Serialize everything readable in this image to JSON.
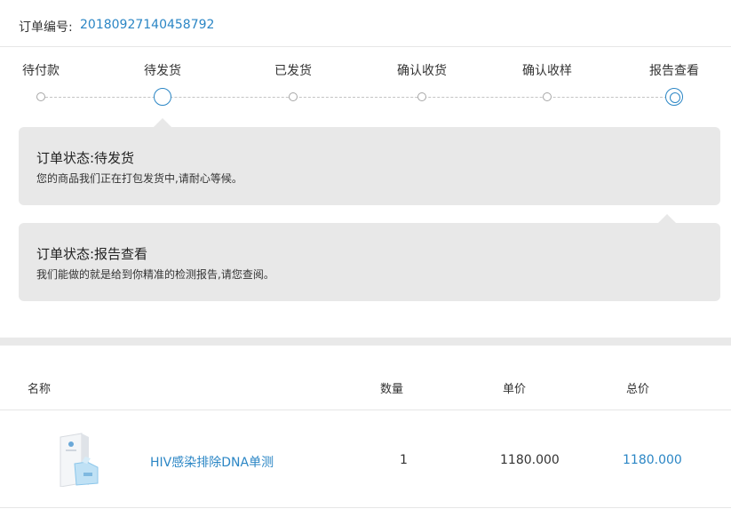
{
  "order": {
    "label": "订单编号:",
    "number": "20180927140458792"
  },
  "steps": [
    {
      "label": "待付款",
      "state": "pending"
    },
    {
      "label": "待发货",
      "state": "current"
    },
    {
      "label": "已发货",
      "state": "pending"
    },
    {
      "label": "确认收货",
      "state": "pending"
    },
    {
      "label": "确认收样",
      "state": "pending"
    },
    {
      "label": "报告查看",
      "state": "highlight"
    }
  ],
  "status_panels": [
    {
      "title": "订单状态:待发货",
      "description": "您的商品我们正在打包发货中,请耐心等候。"
    },
    {
      "title": "订单状态:报告查看",
      "description": "我们能做的就是给到你精准的检测报告,请您查阅。"
    }
  ],
  "table": {
    "headers": {
      "name": "名称",
      "quantity": "数量",
      "unit_price": "单价",
      "total": "总价"
    },
    "rows": [
      {
        "thumbnail_icon": "test-kit-box-icon",
        "name": "HIV感染排除DNA单测",
        "quantity": "1",
        "unit_price": "1180.000",
        "total": "1180.000"
      }
    ]
  },
  "colors": {
    "accent": "#2b86c5",
    "panel_bg": "#e8e8e8",
    "divider_band": "#e9e9e9"
  }
}
